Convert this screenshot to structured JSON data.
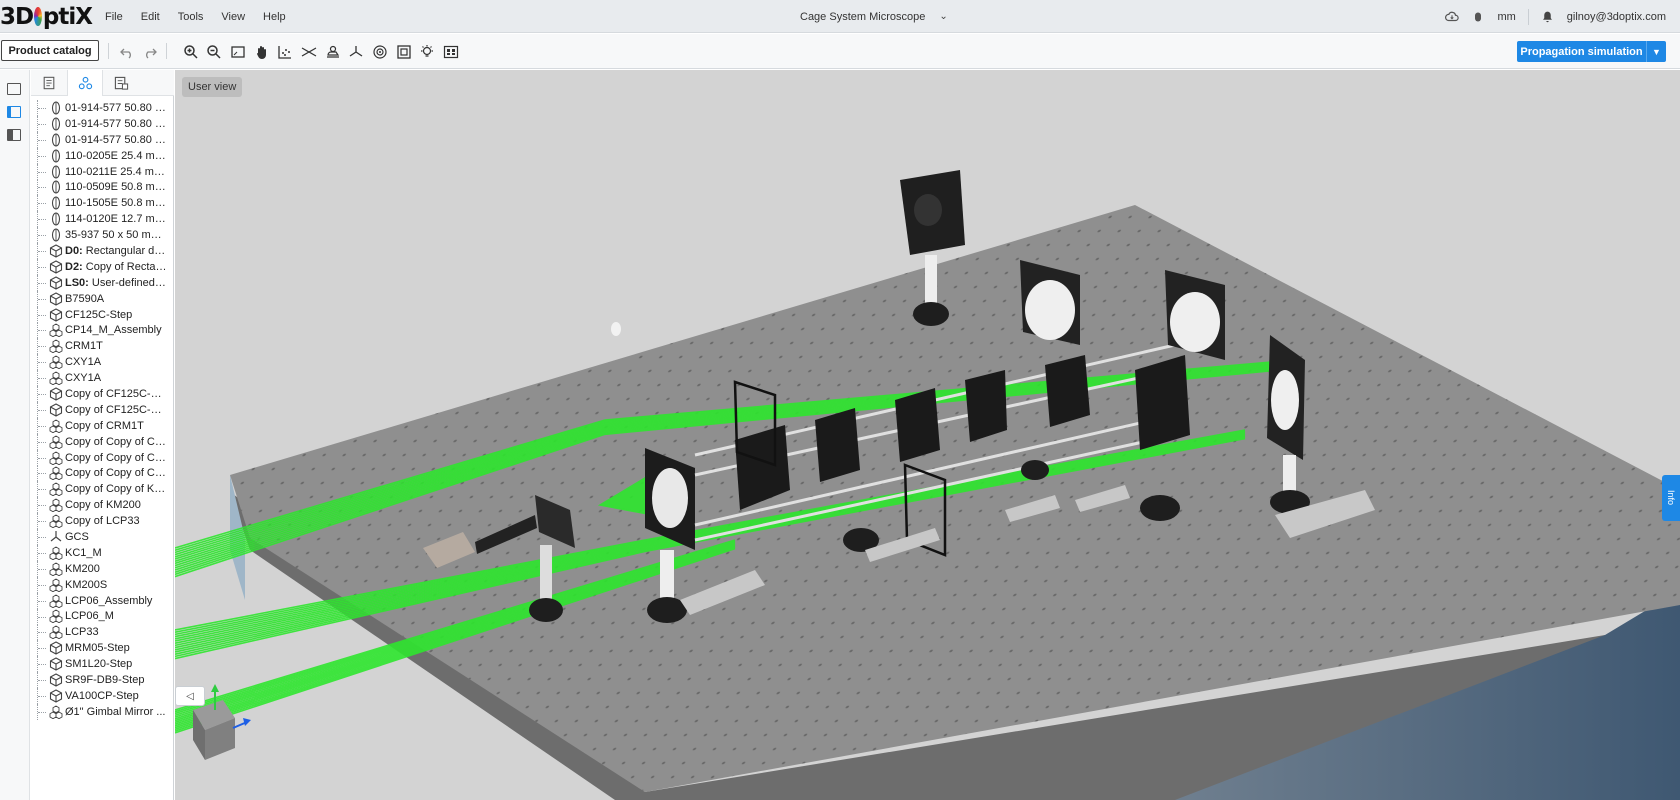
{
  "app": {
    "logo_text_a": "3D",
    "logo_text_b": "ptiX",
    "document_title": "Cage System Microscope",
    "user_email": "gilnoy@3doptix.com",
    "units": "mm"
  },
  "menu": {
    "items": [
      {
        "label": "File"
      },
      {
        "label": "Edit"
      },
      {
        "label": "Tools"
      },
      {
        "label": "View"
      },
      {
        "label": "Help"
      }
    ]
  },
  "toolbar": {
    "catalog_label": "Product catalog",
    "propagation_label": "Propagation simulation",
    "icons": [
      "undo-icon",
      "redo-icon",
      "zoom-in-icon",
      "zoom-out-icon",
      "fit-view-icon",
      "pan-hand-icon",
      "scatter-grid-icon",
      "beam-focus-icon",
      "camera-view-icon",
      "axes-icon",
      "analysis-icon",
      "frame-icon",
      "light-source-icon",
      "bounding-box-icon"
    ]
  },
  "viewport": {
    "view_label": "User view",
    "info_label": "Info"
  },
  "tree": {
    "items": [
      {
        "icon": "lens-icon",
        "prefix": "",
        "label": "01-914-577 50.80 m..."
      },
      {
        "icon": "lens-icon",
        "prefix": "",
        "label": "01-914-577 50.80 m..."
      },
      {
        "icon": "lens-icon",
        "prefix": "",
        "label": "01-914-577 50.80 m..."
      },
      {
        "icon": "lens-icon",
        "prefix": "",
        "label": "110-0205E 25.4 mm..."
      },
      {
        "icon": "lens-icon",
        "prefix": "",
        "label": "110-0211E 25.4 mm..."
      },
      {
        "icon": "lens-icon",
        "prefix": "",
        "label": "110-0509E 50.8 mm..."
      },
      {
        "icon": "lens-icon",
        "prefix": "",
        "label": "110-1505E 50.8 mm..."
      },
      {
        "icon": "lens-icon",
        "prefix": "",
        "label": "114-0120E 12.7 mm..."
      },
      {
        "icon": "lens-icon",
        "prefix": "",
        "label": "35-937 50 x 50 mm ..."
      },
      {
        "icon": "cube-icon",
        "prefix": "D0:",
        "label": " Rectangular det..."
      },
      {
        "icon": "cube-icon",
        "prefix": "D2:",
        "label": " Copy of Rectan..."
      },
      {
        "icon": "cube-icon",
        "prefix": "LS0:",
        "label": " User-defined li..."
      },
      {
        "icon": "cube-icon",
        "prefix": "",
        "label": "B7590A"
      },
      {
        "icon": "cube-icon",
        "prefix": "",
        "label": "CF125C-Step"
      },
      {
        "icon": "assembly-icon",
        "prefix": "",
        "label": "CP14_M_Assembly"
      },
      {
        "icon": "assembly-icon",
        "prefix": "",
        "label": "CRM1T"
      },
      {
        "icon": "assembly-icon",
        "prefix": "",
        "label": "CXY1A"
      },
      {
        "icon": "assembly-icon",
        "prefix": "",
        "label": "CXY1A"
      },
      {
        "icon": "cube-icon",
        "prefix": "",
        "label": "Copy of CF125C-Step"
      },
      {
        "icon": "cube-icon",
        "prefix": "",
        "label": "Copy of CF125C-Step"
      },
      {
        "icon": "assembly-icon",
        "prefix": "",
        "label": "Copy of CRM1T"
      },
      {
        "icon": "assembly-icon",
        "prefix": "",
        "label": "Copy of Copy of CF..."
      },
      {
        "icon": "assembly-icon",
        "prefix": "",
        "label": "Copy of Copy of Co..."
      },
      {
        "icon": "assembly-icon",
        "prefix": "",
        "label": "Copy of Copy of Co..."
      },
      {
        "icon": "assembly-icon",
        "prefix": "",
        "label": "Copy of Copy of KM..."
      },
      {
        "icon": "assembly-icon",
        "prefix": "",
        "label": "Copy of KM200"
      },
      {
        "icon": "assembly-icon",
        "prefix": "",
        "label": "Copy of LCP33"
      },
      {
        "icon": "axes-icon",
        "prefix": "",
        "label": "GCS"
      },
      {
        "icon": "assembly-icon",
        "prefix": "",
        "label": "KC1_M"
      },
      {
        "icon": "assembly-icon",
        "prefix": "",
        "label": "KM200"
      },
      {
        "icon": "assembly-icon",
        "prefix": "",
        "label": "KM200S"
      },
      {
        "icon": "assembly-icon",
        "prefix": "",
        "label": "LCP06_Assembly"
      },
      {
        "icon": "assembly-icon",
        "prefix": "",
        "label": "LCP06_M"
      },
      {
        "icon": "assembly-icon",
        "prefix": "",
        "label": "LCP33"
      },
      {
        "icon": "cube-icon",
        "prefix": "",
        "label": "MRM05-Step"
      },
      {
        "icon": "cube-icon",
        "prefix": "",
        "label": "SM1L20-Step"
      },
      {
        "icon": "cube-icon",
        "prefix": "",
        "label": "SR9F-DB9-Step"
      },
      {
        "icon": "cube-icon",
        "prefix": "",
        "label": "VA100CP-Step"
      },
      {
        "icon": "assembly-icon",
        "prefix": "",
        "label": "Ø1\" Gimbal Mirror ..."
      }
    ]
  },
  "colors": {
    "accent": "#1e88e5",
    "beam": "#2ee62e",
    "table": "#8e8e8e",
    "background": "#d3d3d3"
  }
}
